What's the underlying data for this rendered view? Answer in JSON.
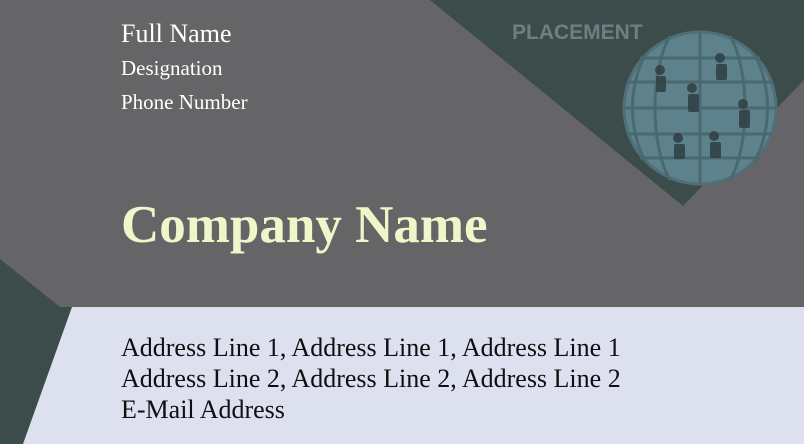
{
  "card": {
    "full_name": "Full Name",
    "designation": "Designation",
    "phone": "Phone Number",
    "company": "Company Name",
    "address_line_1": "Address Line 1, Address Line 1, Address Line 1",
    "address_line_2": "Address Line 2, Address Line 2, Address Line 2",
    "email": "E-Mail Address",
    "watermark_text": "PLACEMENT"
  },
  "colors": {
    "background": "#656467",
    "accent_dark": "#3b4c4a",
    "footer_panel": "#dde0ef",
    "company_text": "#eef7c9",
    "header_text": "#ffffff",
    "footer_text": "#0f0f12"
  },
  "icons": {
    "logo": "globe-logo-icon"
  }
}
